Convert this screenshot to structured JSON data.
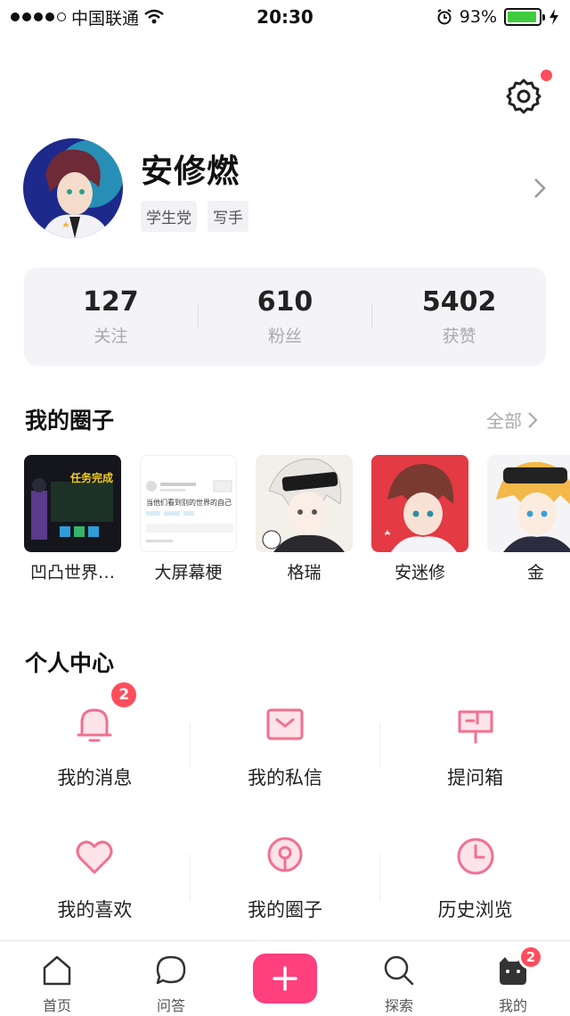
{
  "status_bar": {
    "carrier": "中国联通",
    "time": "20:30",
    "battery_pct": "93%",
    "battery_level": 0.93
  },
  "profile": {
    "name": "安修燃",
    "tags": [
      "学生党",
      "写手"
    ]
  },
  "stats": [
    {
      "value": "127",
      "label": "关注"
    },
    {
      "value": "610",
      "label": "粉丝"
    },
    {
      "value": "5402",
      "label": "获赞"
    }
  ],
  "circles_section": {
    "title": "我的圈子",
    "see_all": "全部"
  },
  "circles": [
    {
      "name": "凹凸世界…"
    },
    {
      "name": "大屏幕梗"
    },
    {
      "name": "格瑞"
    },
    {
      "name": "安迷修"
    },
    {
      "name": "金"
    }
  ],
  "thumb_texts": {
    "mission": "任务完成",
    "post_title": "当他们看到别的世界的自己"
  },
  "center": {
    "title": "个人中心",
    "items": [
      {
        "label": "我的消息",
        "icon": "bell-icon",
        "badge": "2"
      },
      {
        "label": "我的私信",
        "icon": "mail-icon"
      },
      {
        "label": "提问箱",
        "icon": "mailbox-icon"
      },
      {
        "label": "我的喜欢",
        "icon": "heart-icon"
      },
      {
        "label": "我的圈子",
        "icon": "circle-pin-icon"
      },
      {
        "label": "历史浏览",
        "icon": "clock-icon"
      }
    ]
  },
  "tabbar": [
    {
      "label": "首页",
      "icon": "home-icon"
    },
    {
      "label": "问答",
      "icon": "chat-icon"
    },
    {
      "label": "",
      "icon": "plus-icon"
    },
    {
      "label": "探索",
      "icon": "search-icon"
    },
    {
      "label": "我的",
      "icon": "cat-icon",
      "badge": "2"
    }
  ],
  "colors": {
    "accent": "#ff3f7e",
    "icon_pink": "#f2708f",
    "badge": "#ff4d5c"
  }
}
